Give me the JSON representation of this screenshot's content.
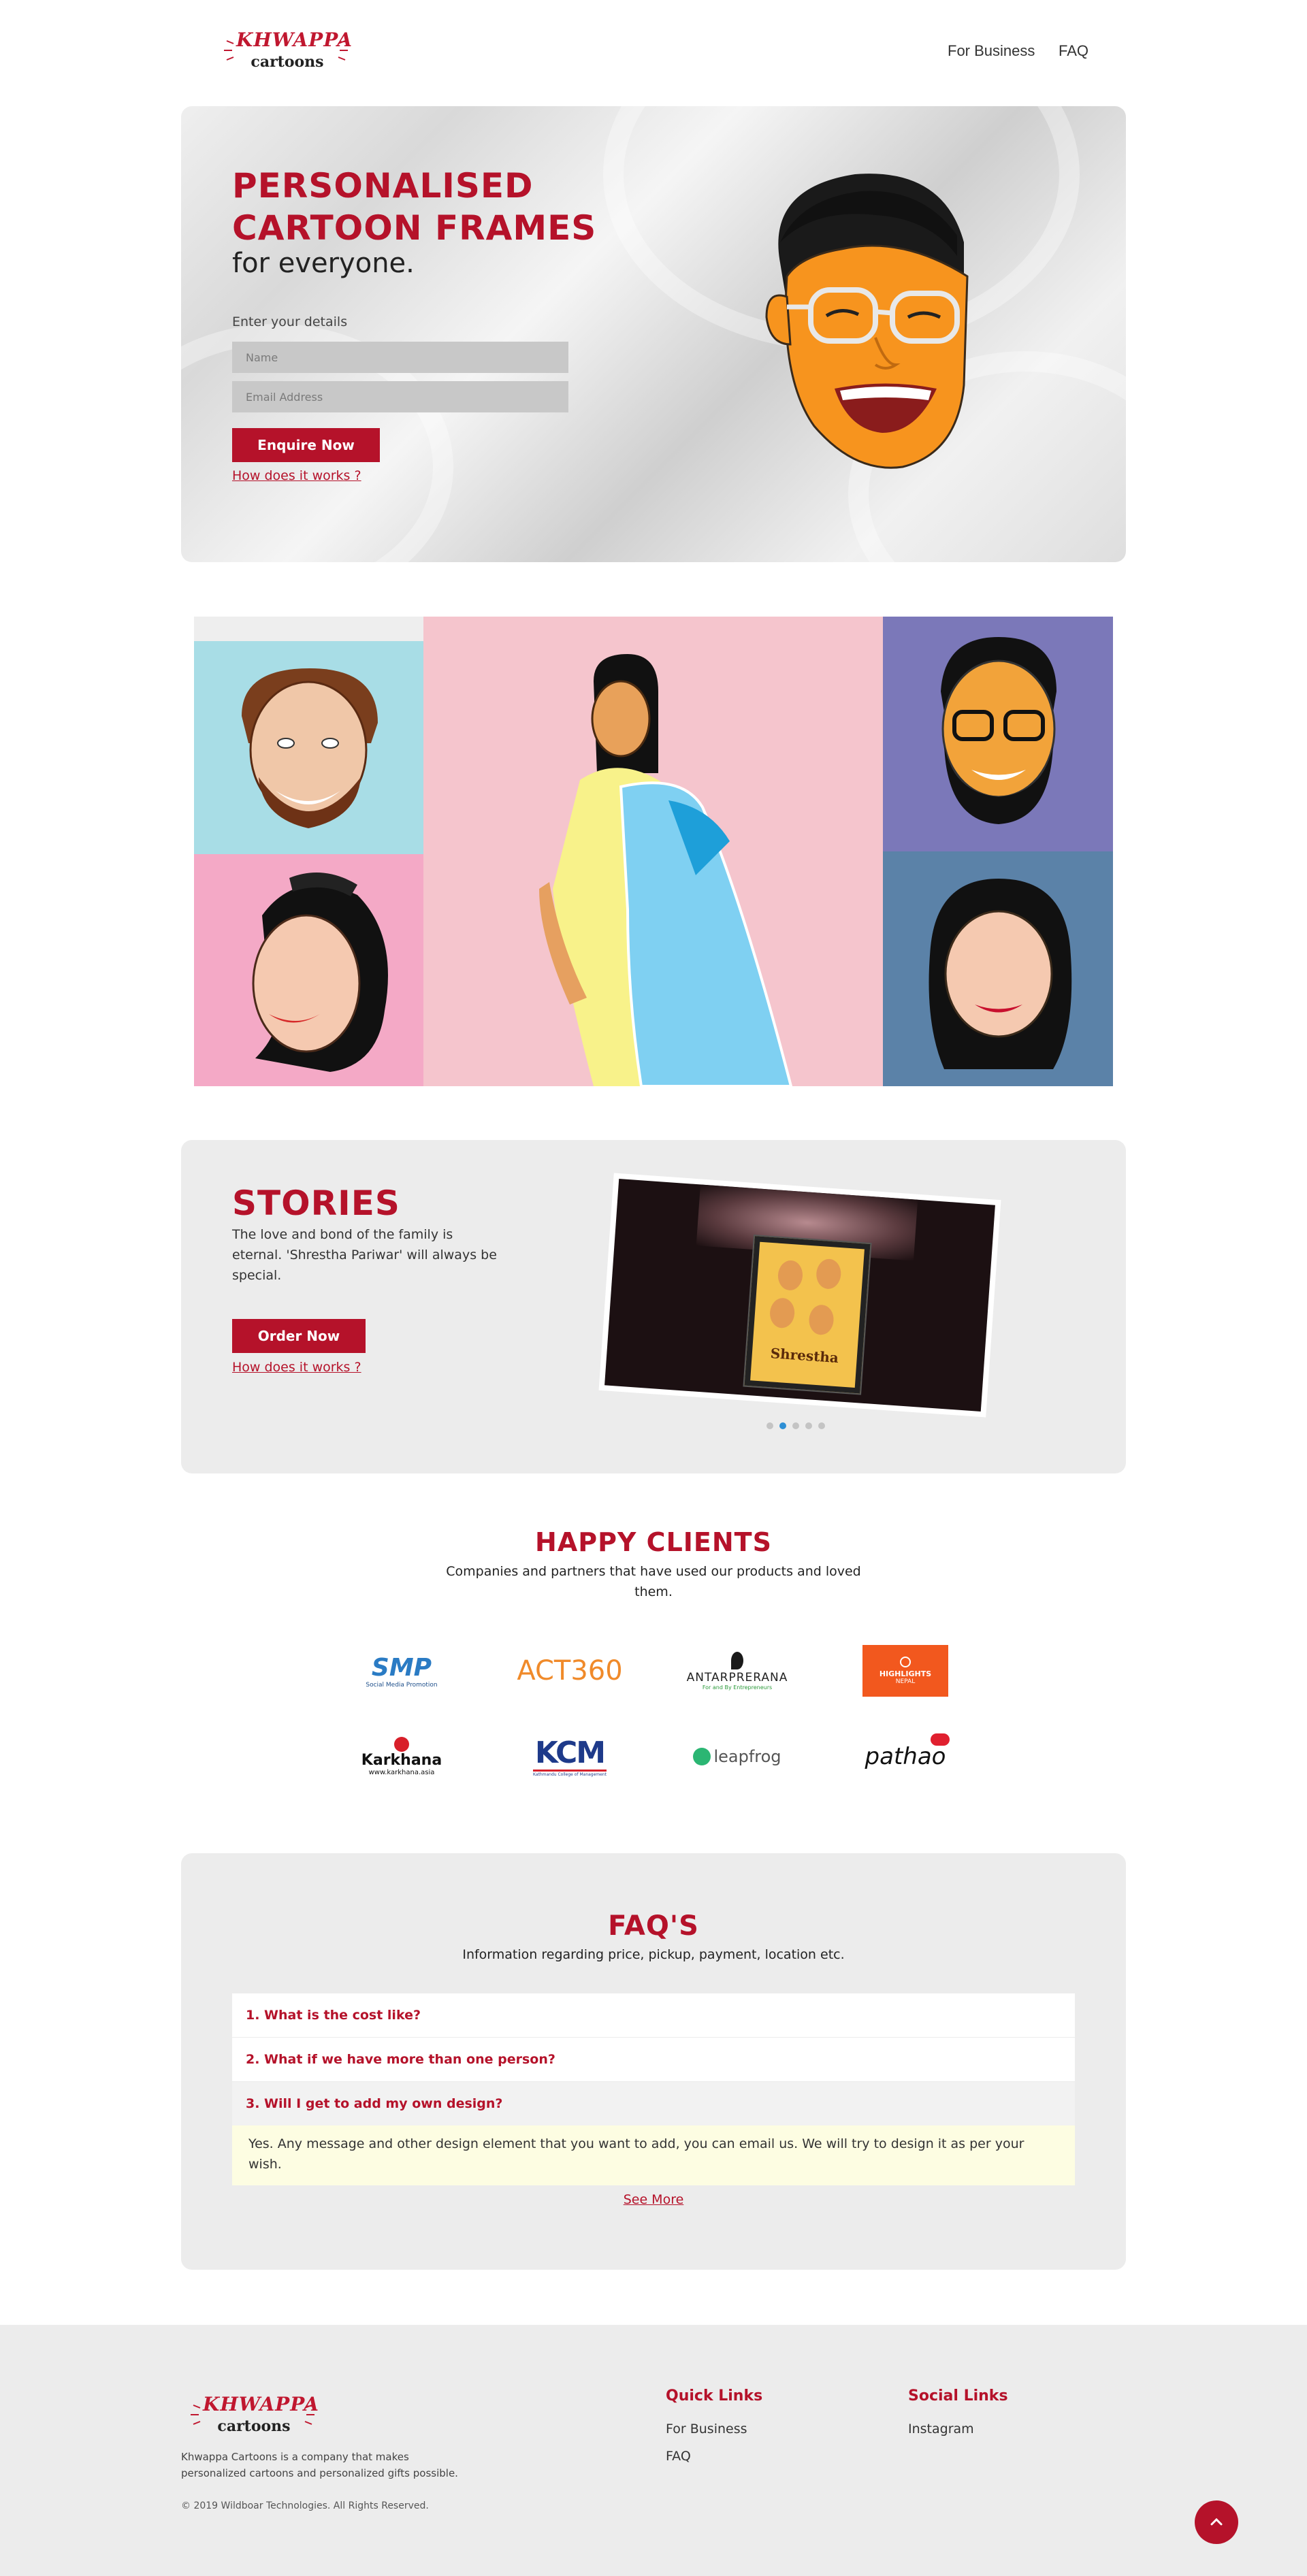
{
  "brand": {
    "logo_top": "KHWAPPA",
    "logo_bottom": "cartoons",
    "color_primary": "#b5122a"
  },
  "nav": {
    "items": [
      {
        "label": "For Business"
      },
      {
        "label": "FAQ"
      }
    ]
  },
  "hero": {
    "title_line1": "PERSONALISED",
    "title_line2": "CARTOON FRAMES",
    "subtitle": "for everyone.",
    "form_label": "Enter your details",
    "name_placeholder": "Name",
    "email_placeholder": "Email Address",
    "enquire_label": "Enquire Now",
    "how_label": "How does it works ?"
  },
  "stories": {
    "title": "STORIES",
    "text": "The love and bond of the family is eternal. 'Shrestha Pariwar' will always be special.",
    "order_label": "Order Now",
    "how_label": "How does it works ?",
    "frame_caption": "Shrestha",
    "slides": 5,
    "active_slide": 2
  },
  "clients": {
    "title": "HAPPY CLIENTS",
    "subtitle": "Companies and partners that have used our products and loved them.",
    "logos": [
      {
        "name": "SMP",
        "caption": "Social Media Promotion"
      },
      {
        "name": "ACT360"
      },
      {
        "name": "ANTARPRERANA",
        "caption": "For and By Entrepreneurs"
      },
      {
        "name": "HIGHLIGHTS",
        "caption": "NEPAL"
      },
      {
        "name": "Karkhana",
        "caption": "www.karkhana.asia"
      },
      {
        "name": "KCM",
        "caption": "Kathmandu College of Management"
      },
      {
        "name": "leapfrog"
      },
      {
        "name": "pathao"
      }
    ]
  },
  "faq": {
    "title": "FAQ'S",
    "subtitle": "Information regarding price, pickup, payment, location etc.",
    "questions": [
      {
        "q": "1. What is the cost like?"
      },
      {
        "q": "2. What if we have more than one person?"
      },
      {
        "q": "3. Will I get to add my own design?"
      }
    ],
    "open_answer": "Yes. Any message and other design element that you want to add, you can email us. We will try to design it as per your wish.",
    "see_more": "See More"
  },
  "footer": {
    "description": "Khwappa Cartoons is a company that makes personalized cartoons and personalized gifts possible.",
    "copyright": "© 2019 Wildboar Technologies. All Rights Reserved.",
    "quick_links_title": "Quick Links",
    "quick_links": [
      {
        "label": "For Business"
      },
      {
        "label": "FAQ"
      }
    ],
    "social_title": "Social Links",
    "social_links": [
      {
        "label": "Instagram"
      }
    ]
  }
}
